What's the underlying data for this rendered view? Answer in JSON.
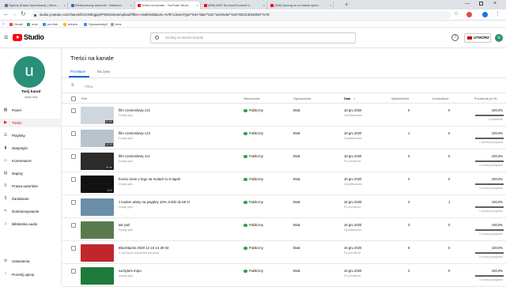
{
  "browser": {
    "tabs": [
      {
        "title": "Ogólny (Klasa Spodniowa) | Micro...",
        "color": "#6264a7"
      },
      {
        "title": "Elektroniczny dziennik - Wiadom...",
        "color": "#2f6eb5"
      },
      {
        "title": "Treści na kanale - YouTube Studi...",
        "color": "#ff0000"
      },
      {
        "title": "(896) ARK Survival Evolved C...",
        "color": "#ff0000"
      },
      {
        "title": "(335) Among us w miasie speci...",
        "color": "#ff0000"
      }
    ],
    "url": "studio.youtube.com/channel/UCH8Eqg4pFFDD/videos/upload?filter=%5B%5D&sort=%7B\"columnType\"%3A\"date\"%2C\"sortOrder\"%3A\"DESCENDING\"%7D",
    "bookmarks": [
      "Gmail",
      "mob",
      "pro-link",
      "eduers",
      "Sprawdzany2",
      "bms"
    ]
  },
  "header": {
    "logo": "Studio",
    "search_placeholder": "Szukaj na swoim kanale",
    "create_label": "UTWÓRZ"
  },
  "sidebar": {
    "avatar_letter": "u",
    "channel_title": "Twój kanał",
    "channel_name": "uwey mój",
    "items": [
      {
        "label": "Panel",
        "icon": "dashboard-icon"
      },
      {
        "label": "Treści",
        "icon": "content-icon",
        "active": true
      },
      {
        "label": "Playlisty",
        "icon": "playlist-icon"
      },
      {
        "label": "Statystyki",
        "icon": "analytics-icon"
      },
      {
        "label": "Komentarze",
        "icon": "comments-icon"
      },
      {
        "label": "Napisy",
        "icon": "subtitles-icon"
      },
      {
        "label": "Prawa autorskie",
        "icon": "copyright-icon"
      },
      {
        "label": "Zarabianie",
        "icon": "monetization-icon"
      },
      {
        "label": "Dostosowywanie",
        "icon": "customization-icon"
      },
      {
        "label": "Biblioteka audio",
        "icon": "audio-library-icon"
      }
    ],
    "bottom_items": [
      {
        "label": "Ustawienia",
        "icon": "settings-icon"
      },
      {
        "label": "Prześlij opinię",
        "icon": "feedback-icon"
      }
    ]
  },
  "main": {
    "page_title": "Treści na kanale",
    "tabs": [
      {
        "label": "Przesłane",
        "active": true
      },
      {
        "label": "Na żywo",
        "active": false
      }
    ],
    "filter_placeholder": "Filtruj",
    "columns": {
      "film": "Film",
      "visibility": "Widoczność",
      "restrictions": "Ograniczenia",
      "date": "Data",
      "views": "Wyświetlenia",
      "comments": "Komentarze",
      "likes": "Polubienia (w %)"
    },
    "rows": [
      {
        "title": "film czenioslowy cz2",
        "desc": "Dodaj opis",
        "duration": "20:50",
        "visibility": "Publiczny",
        "restriction": "Brak",
        "date": "18 gru 2020",
        "date_sub": "Opublikowano",
        "views": "0",
        "comments": "0",
        "likes_pct": "100,0%",
        "likes_fill": 1.0,
        "likes_sub": "1 polubienie",
        "thumb": "#cfd6dd"
      },
      {
        "title": "film czenioslowy cz3",
        "desc": "Dodaj opis",
        "duration": "13:33",
        "visibility": "Publiczny",
        "restriction": "Brak",
        "date": "18 gru 2020",
        "date_sub": "Opublikowano",
        "views": "1",
        "comments": "0",
        "likes_pct": "100,0%",
        "likes_fill": 1.0,
        "likes_sub": "1 ocena pozytywna",
        "thumb": "#b9c3cc"
      },
      {
        "title": "film czenioslowy cz1",
        "desc": "Dodaj opis",
        "duration": "20:50",
        "visibility": "Publiczny",
        "restriction": "Brak",
        "date": "18 gru 2020",
        "date_sub": "Po premierze",
        "views": "0",
        "comments": "0",
        "likes_pct": "100,0%",
        "likes_fill": 1.0,
        "likes_sub": "2 oceny pozytywne",
        "thumb": "#2c2c2c"
      },
      {
        "title": "hcecie serie z lego na molach to 5 lapek",
        "desc": "Dodaj opis",
        "duration": "3:21",
        "visibility": "Publiczny",
        "restriction": "Brak",
        "date": "16 gru 2020",
        "date_sub": "Opublikowano",
        "views": "2",
        "comments": "0",
        "likes_pct": "100,0%",
        "likes_fill": 1.0,
        "likes_sub": "2 oceny pozytywne",
        "thumb": "#111111"
      },
      {
        "title": "z kodem ulany na paypley 10% zniżki do 50 zł",
        "desc": "Dodaj opis",
        "duration": "",
        "visibility": "Publiczny",
        "restriction": "Brak",
        "date": "16 gru 2020",
        "date_sub": "Po premierze",
        "views": "3",
        "comments": "1",
        "likes_pct": "100,0%",
        "likes_fill": 1.0,
        "likes_sub": "1 ocena pozytywna",
        "thumb": "#6a8fa8"
      },
      {
        "title": "ale pań",
        "desc": "Dodaj opis",
        "duration": "",
        "visibility": "Publiczny",
        "restriction": "Brak",
        "date": "15 gru 2020",
        "date_sub": "Opublikowano",
        "views": "3",
        "comments": "0",
        "likes_pct": "100,0%",
        "likes_fill": 1.0,
        "likes_sub": "2 oceny pozytywne",
        "thumb": "#5a7a4e"
      },
      {
        "title": "BlueStacks 2020 12 15 14 29 02",
        "desc": "1 nas imps dopcbnen bouccas",
        "duration": "",
        "visibility": "Publiczny",
        "restriction": "Brak",
        "date": "15 gru 2020",
        "date_sub": "Po premierze",
        "views": "6",
        "comments": "0",
        "likes_pct": "100,0%",
        "likes_fill": 1.0,
        "likes_sub": "2 oceny pozytywne",
        "thumb": "#c0272d"
      },
      {
        "title": "na bytem impo",
        "desc": "Dodaj opis",
        "duration": "",
        "visibility": "Publiczny",
        "restriction": "Brak",
        "date": "15 gru 2020",
        "date_sub": "Po premierze",
        "views": "2",
        "comments": "0",
        "likes_pct": "100,0%",
        "likes_fill": 1.0,
        "likes_sub": "2 oceny pozytywne",
        "thumb": "#1e7a3a"
      }
    ]
  }
}
